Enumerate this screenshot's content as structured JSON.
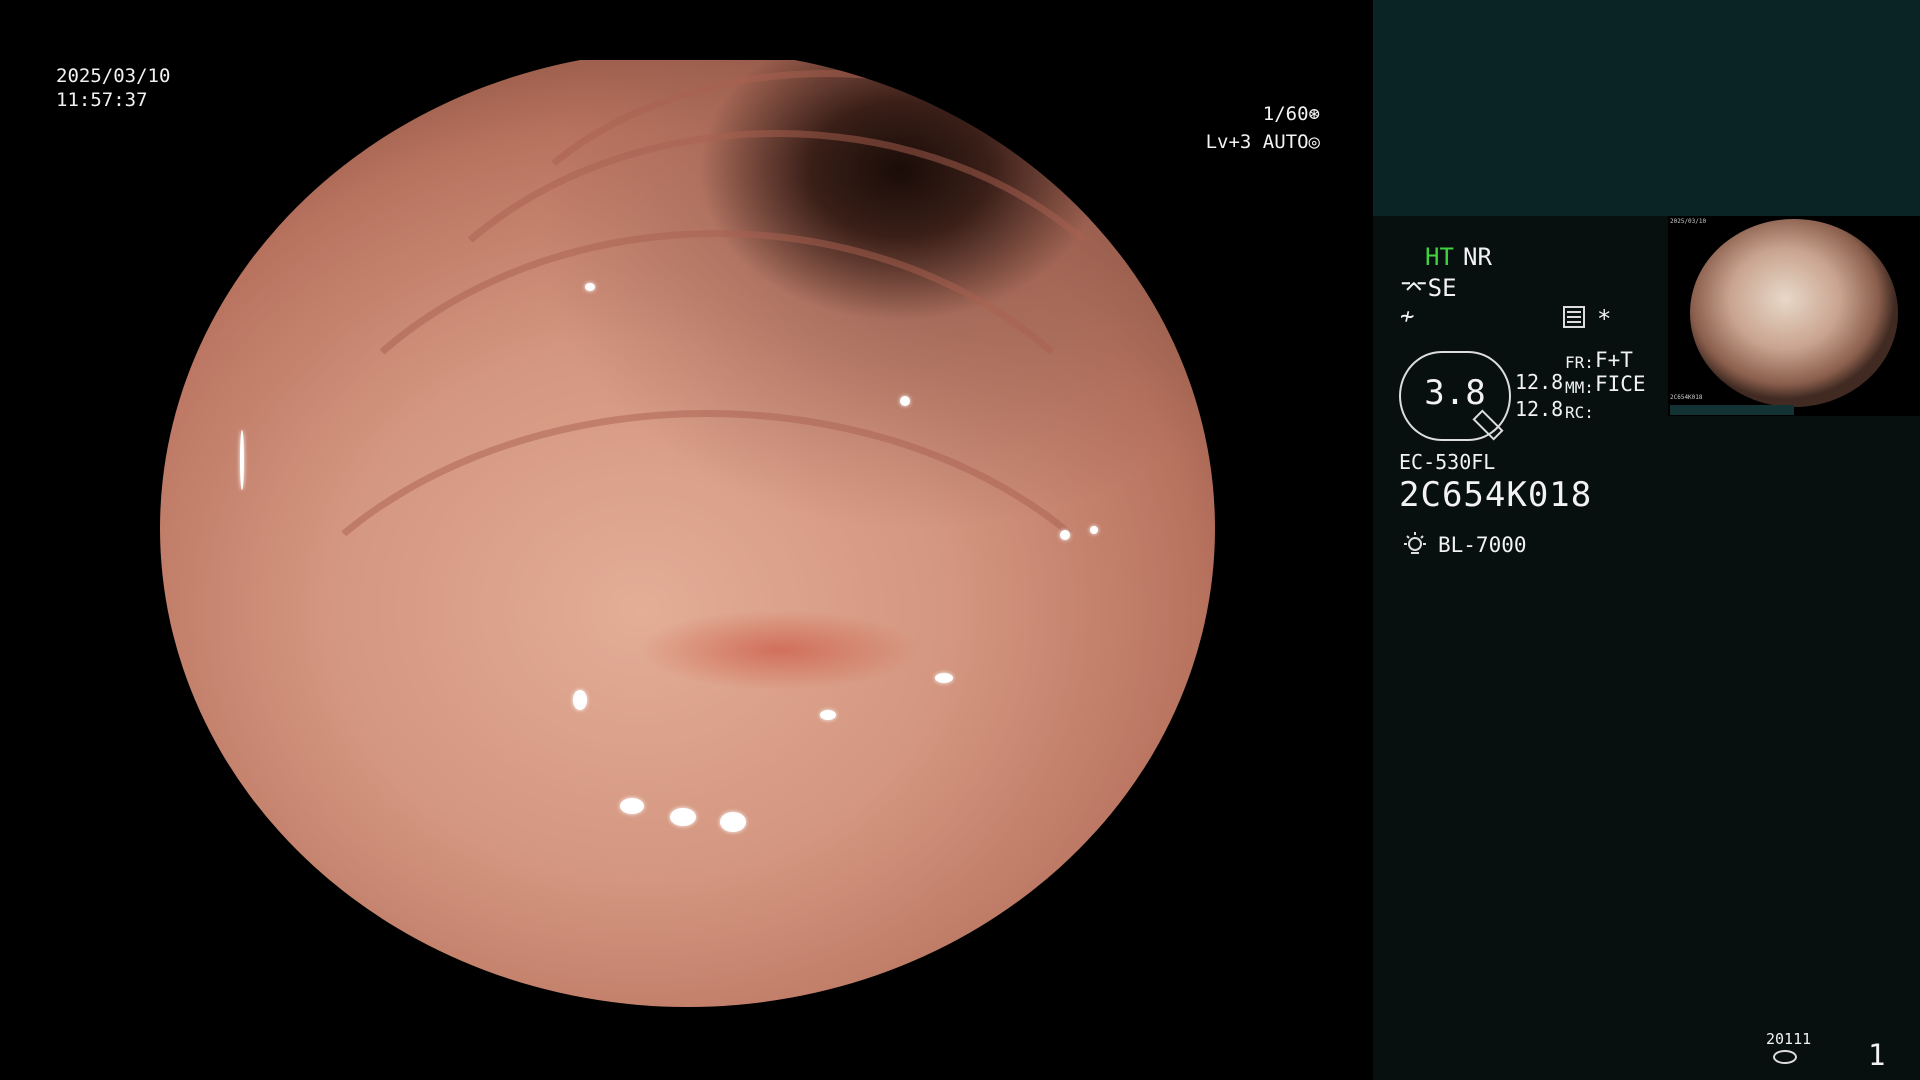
{
  "overlay": {
    "date": "2025/03/10",
    "time": "11:57:37",
    "shutter": "1/60",
    "level": "Lv+3",
    "iris": "AUTO"
  },
  "panel": {
    "ht": "HT",
    "nr": "NR",
    "se": "SE",
    "gauge_value": "3.8",
    "value1": "12.8",
    "value2": "12.8",
    "fr_label": "FR:",
    "fr_value": "F+T",
    "mm_label": "MM:",
    "mm_value": "FICE",
    "rc_label": "RC:",
    "scope_model": "EC-530FL",
    "scope_serial": "2C654K018",
    "light_source": "BL-7000",
    "counter": "20111",
    "page_number": "1",
    "thumbnail_date": "2025/03/10",
    "thumbnail_serial": "2C654K018"
  },
  "colors": {
    "ht_green": "#3fd43f",
    "panel_top": "#0a2325",
    "panel_bg": "#07100f"
  },
  "icons": {
    "shutter": "shutter-icon",
    "iris": "iris-icon",
    "se": "scope-edge-icon",
    "f": "structure-icon",
    "menu": "settings-list-icon",
    "light": "lamp-icon",
    "disk": "storage-disk-icon"
  }
}
